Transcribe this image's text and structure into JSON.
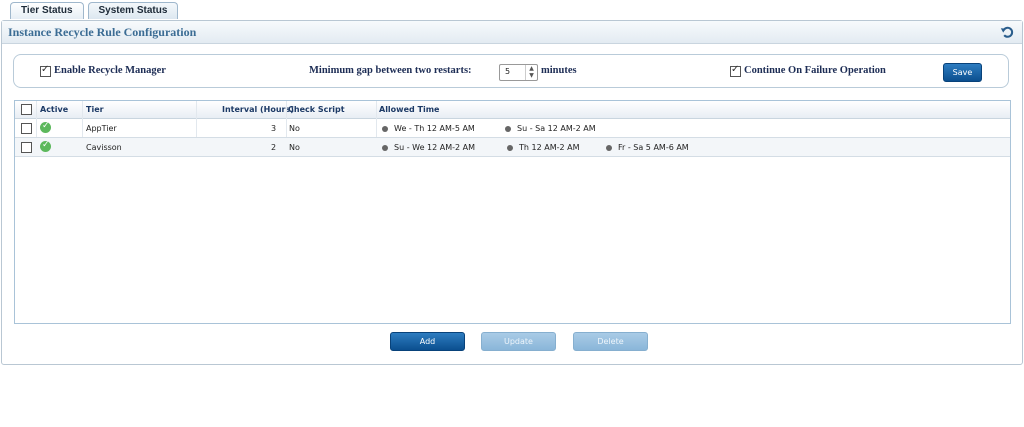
{
  "tabs": [
    {
      "label": "Tier Status"
    },
    {
      "label": "System Status"
    }
  ],
  "header": {
    "title": "Instance Recycle Rule Configuration"
  },
  "options": {
    "enable_recycle_label": "Enable Recycle Manager",
    "enable_recycle_checked": true,
    "min_gap_label": "Minimum gap between two restarts:",
    "min_gap_value": "5",
    "min_gap_unit": "minutes",
    "continue_failure_label": "Continue On Failure Operation",
    "continue_failure_checked": true,
    "save_label": "Save"
  },
  "table": {
    "columns": [
      "Active",
      "Tier",
      "Interval (Hours)",
      "Check Script",
      "Allowed Time"
    ],
    "rows": [
      {
        "active": true,
        "tier": "AppTier",
        "interval": "3",
        "check_script": "No",
        "allowed_time": [
          "We - Th 12 AM-5 AM",
          "Su - Sa 12 AM-2 AM"
        ]
      },
      {
        "active": true,
        "tier": "Cavisson",
        "interval": "2",
        "check_script": "No",
        "allowed_time": [
          "Su - We 12 AM-2 AM",
          "Th 12 AM-2 AM",
          "Fr - Sa 5 AM-6 AM"
        ]
      }
    ]
  },
  "actions": {
    "add": "Add",
    "update": "Update",
    "delete": "Delete"
  },
  "colors": {
    "title": "#3b6c94",
    "primary_button": "#0b4f8f",
    "active_icon": "#5cb85c"
  }
}
